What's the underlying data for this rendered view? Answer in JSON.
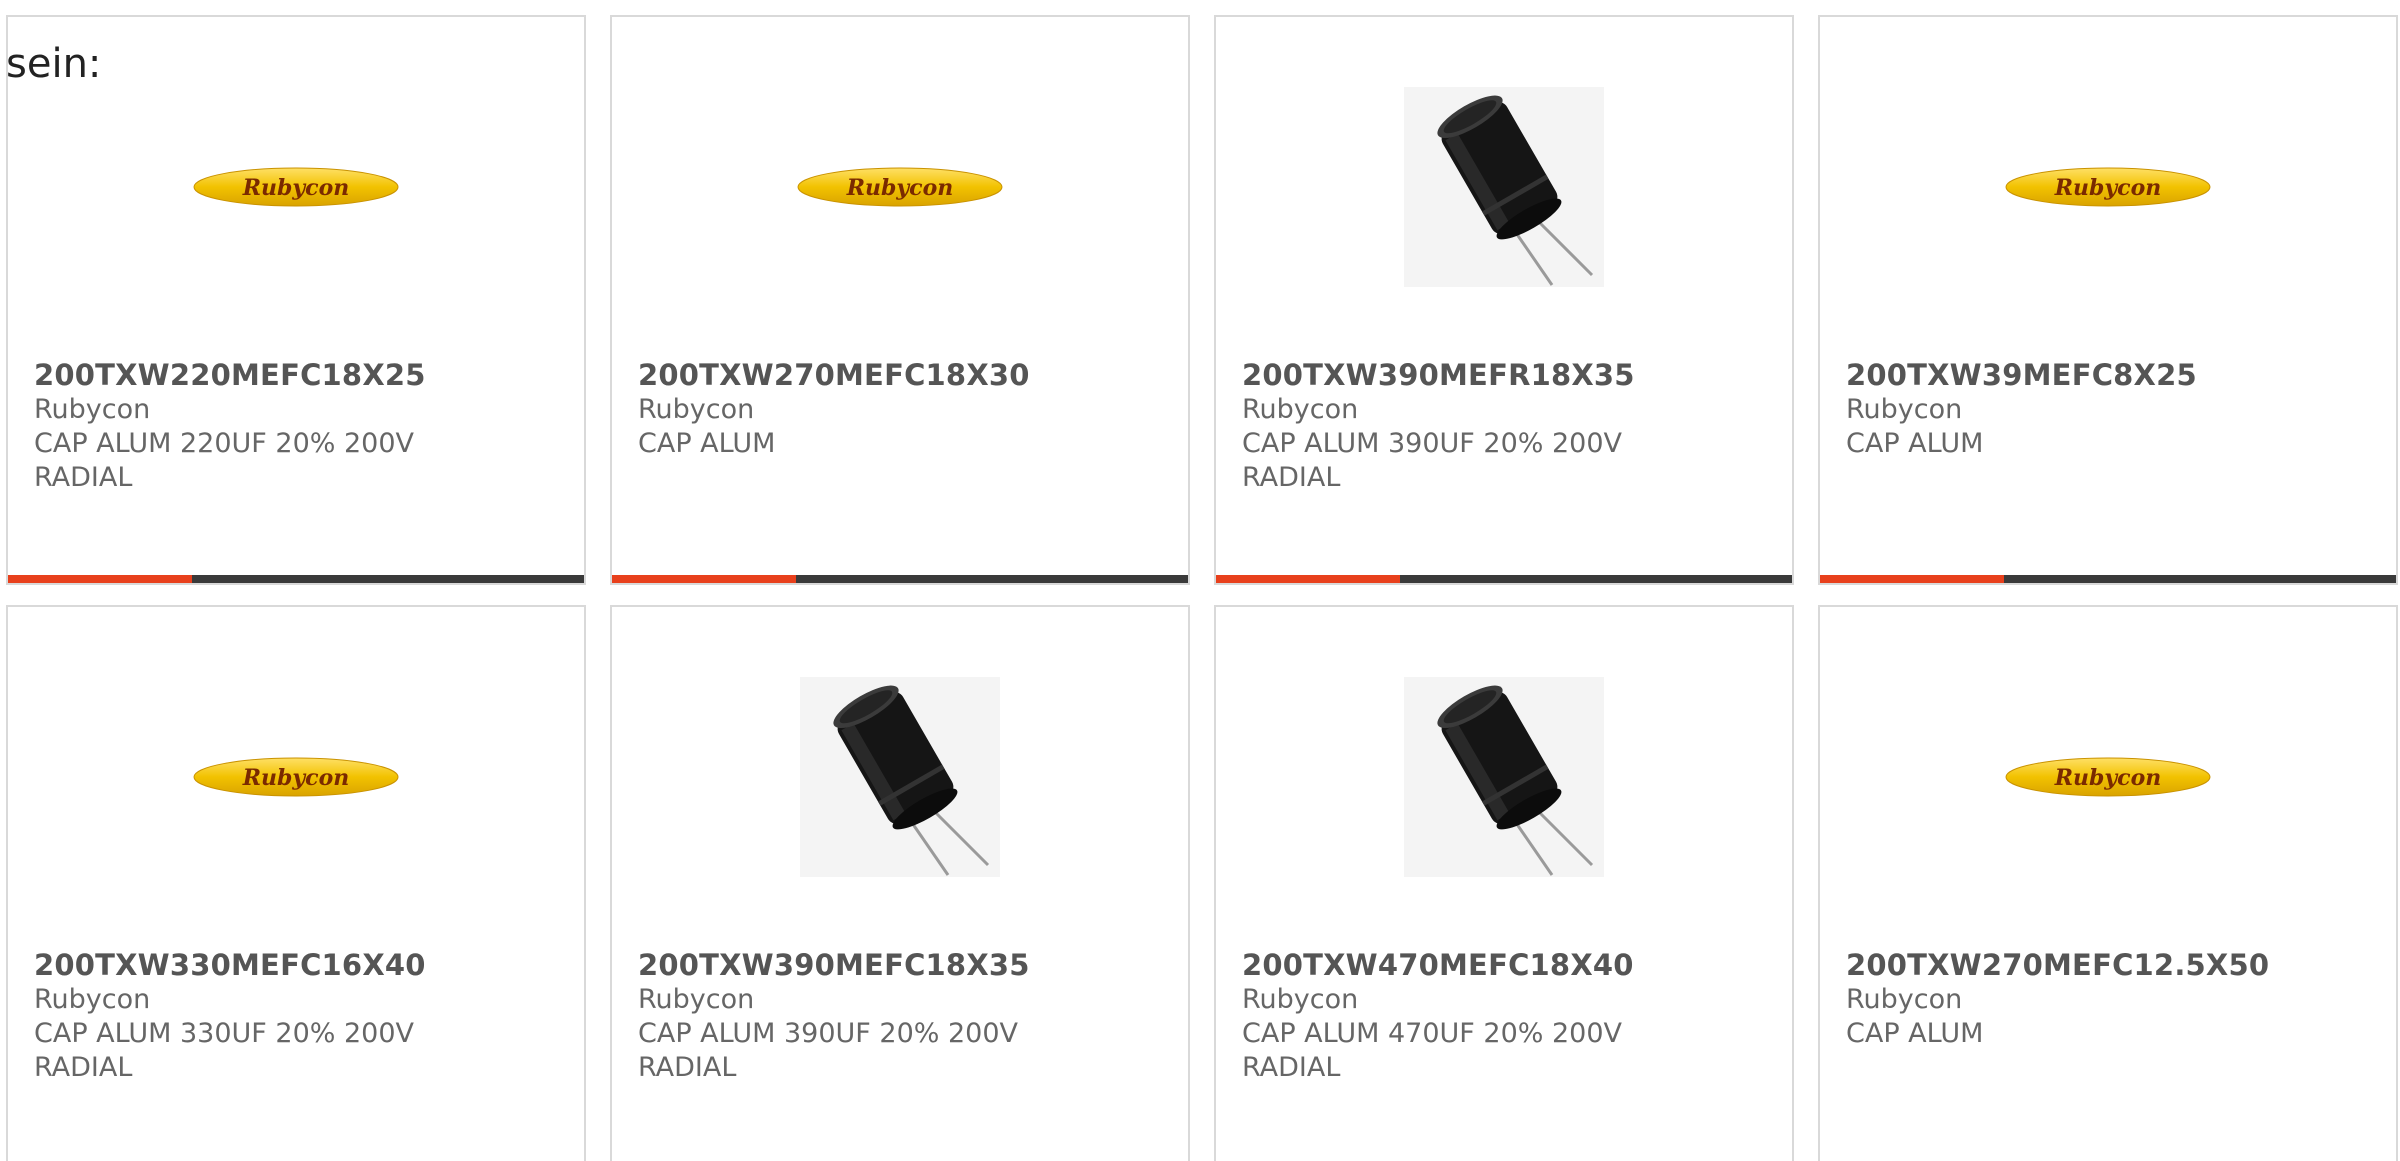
{
  "intro_text": "sein:",
  "colors": {
    "accent": "#e8401c",
    "bar_track": "#3a3a3a",
    "logo_yellow": "#f2c200",
    "logo_text": "#7a2a00",
    "capacitor": "#151515"
  },
  "products": [
    {
      "part": "200TXW220MEFC18X25",
      "mfr": "Rubycon",
      "desc": "CAP ALUM 220UF 20% 200V\nRADIAL",
      "image": "rubycon-logo",
      "logo_text": "Rubycon",
      "progress": 0.32
    },
    {
      "part": "200TXW270MEFC18X30",
      "mfr": "Rubycon",
      "desc": "CAP ALUM",
      "image": "rubycon-logo",
      "logo_text": "Rubycon",
      "progress": 0.32
    },
    {
      "part": "200TXW390MEFR18X35",
      "mfr": "Rubycon",
      "desc": "CAP ALUM 390UF 20% 200V\nRADIAL",
      "image": "capacitor-photo",
      "logo_text": "",
      "progress": 0.32
    },
    {
      "part": "200TXW39MEFC8X25",
      "mfr": "Rubycon",
      "desc": "CAP ALUM",
      "image": "rubycon-logo",
      "logo_text": "Rubycon",
      "progress": 0.32
    },
    {
      "part": "200TXW330MEFC16X40",
      "mfr": "Rubycon",
      "desc": "CAP ALUM 330UF 20% 200V\nRADIAL",
      "image": "rubycon-logo",
      "logo_text": "Rubycon",
      "progress": null
    },
    {
      "part": "200TXW390MEFC18X35",
      "mfr": "Rubycon",
      "desc": "CAP ALUM 390UF 20% 200V\nRADIAL",
      "image": "capacitor-photo",
      "logo_text": "",
      "progress": null
    },
    {
      "part": "200TXW470MEFC18X40",
      "mfr": "Rubycon",
      "desc": "CAP ALUM 470UF 20% 200V\nRADIAL",
      "image": "capacitor-photo",
      "logo_text": "",
      "progress": null
    },
    {
      "part": "200TXW270MEFC12.5X50",
      "mfr": "Rubycon",
      "desc": "CAP ALUM",
      "image": "rubycon-logo",
      "logo_text": "Rubycon",
      "progress": null
    }
  ]
}
